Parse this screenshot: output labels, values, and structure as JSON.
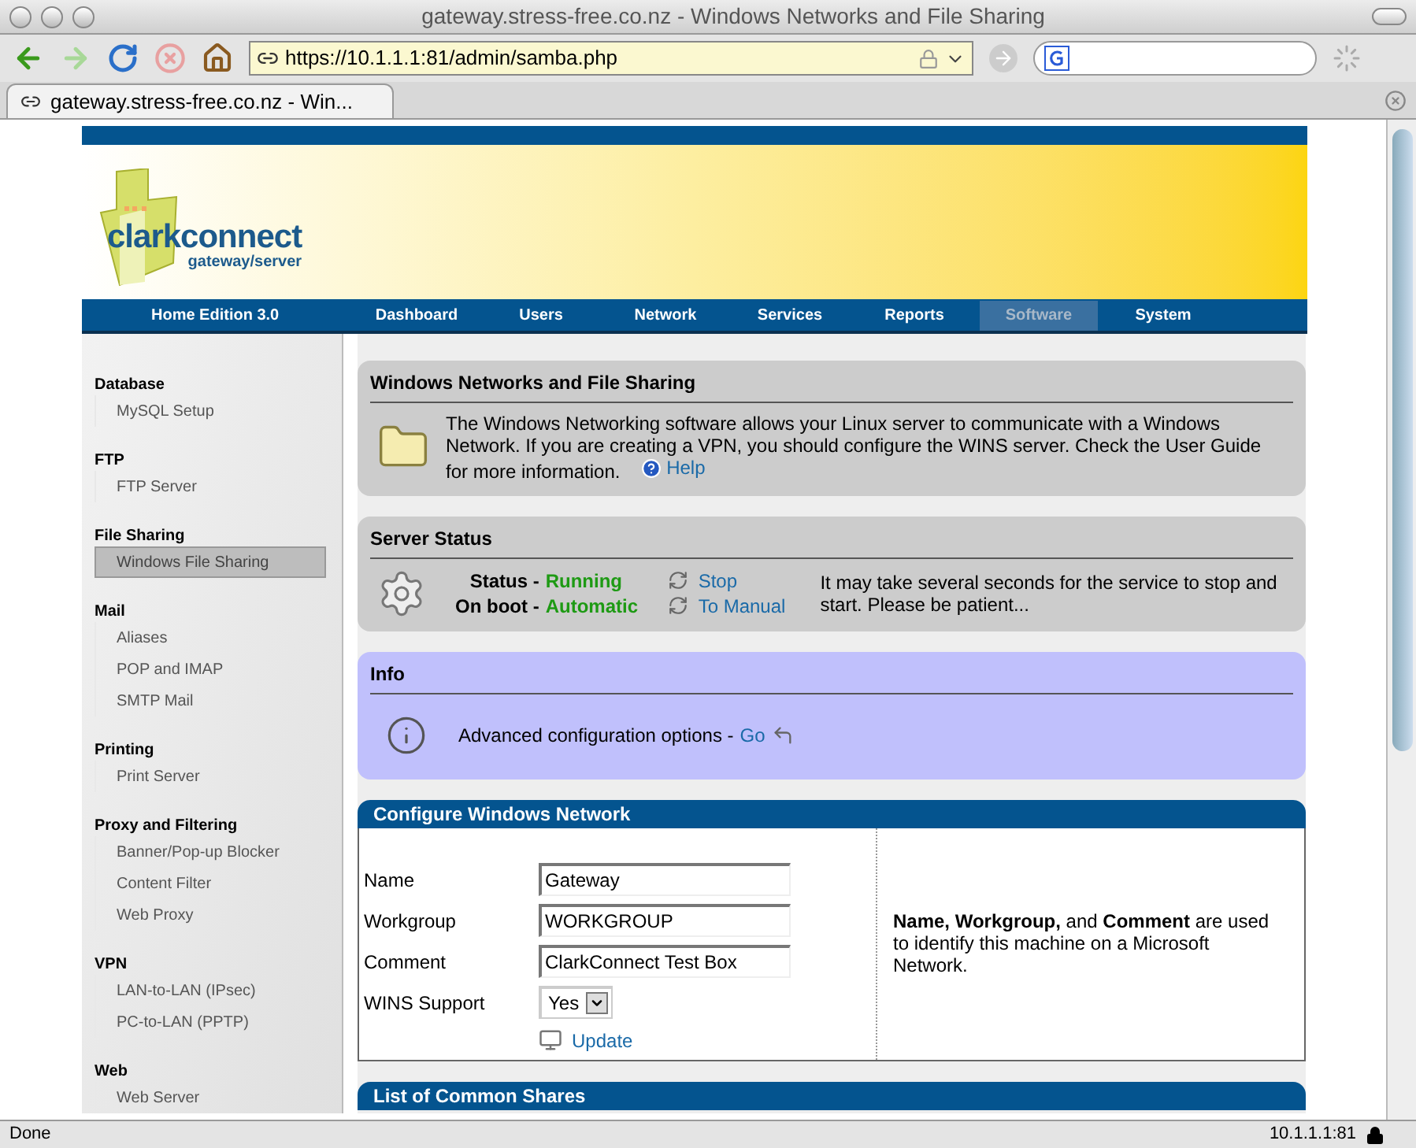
{
  "window": {
    "title": "gateway.stress-free.co.nz - Windows Networks and File Sharing"
  },
  "toolbar": {
    "url": "https://10.1.1.1:81/admin/samba.php"
  },
  "tabs": [
    {
      "label": "gateway.stress-free.co.nz - Win...",
      "selected": true
    }
  ],
  "page": {
    "brand": {
      "name": "clarkconnect",
      "tagline": "gateway/server"
    },
    "edition": "Home Edition 3.0",
    "nav": [
      {
        "label": "Dashboard",
        "selected": false
      },
      {
        "label": "Users",
        "selected": false
      },
      {
        "label": "Network",
        "selected": false
      },
      {
        "label": "Services",
        "selected": false
      },
      {
        "label": "Reports",
        "selected": false
      },
      {
        "label": "Software",
        "selected": true
      },
      {
        "label": "System",
        "selected": false
      }
    ],
    "sidebar": [
      {
        "title": "Database",
        "items": [
          {
            "label": "MySQL Setup",
            "selected": false
          }
        ]
      },
      {
        "title": "FTP",
        "items": [
          {
            "label": "FTP Server",
            "selected": false
          }
        ]
      },
      {
        "title": "File Sharing",
        "items": [
          {
            "label": "Windows File Sharing",
            "selected": true
          }
        ]
      },
      {
        "title": "Mail",
        "items": [
          {
            "label": "Aliases",
            "selected": false
          },
          {
            "label": "POP and IMAP",
            "selected": false
          },
          {
            "label": "SMTP Mail",
            "selected": false
          }
        ]
      },
      {
        "title": "Printing",
        "items": [
          {
            "label": "Print Server",
            "selected": false
          }
        ]
      },
      {
        "title": "Proxy and Filtering",
        "items": [
          {
            "label": "Banner/Pop-up Blocker",
            "selected": false
          },
          {
            "label": "Content Filter",
            "selected": false
          },
          {
            "label": "Web Proxy",
            "selected": false
          }
        ]
      },
      {
        "title": "VPN",
        "items": [
          {
            "label": "LAN-to-LAN (IPsec)",
            "selected": false
          },
          {
            "label": "PC-to-LAN (PPTP)",
            "selected": false
          }
        ]
      },
      {
        "title": "Web",
        "items": [
          {
            "label": "Web Server",
            "selected": false
          }
        ]
      }
    ],
    "intro": {
      "title": "Windows Networks and File Sharing",
      "text": "The Windows Networking software allows your Linux server to communicate with a Windows Network.  If you are creating a VPN, you should configure the WINS server.  Check the User Guide for more information.",
      "help": "Help"
    },
    "server_status": {
      "title": "Server Status",
      "rows": [
        {
          "label": "Status -",
          "value": "Running",
          "action": "Stop"
        },
        {
          "label": "On boot -",
          "value": "Automatic",
          "action": "To Manual"
        }
      ],
      "note": "It may take several seconds for the service to stop and start.  Please be patient..."
    },
    "info": {
      "title": "Info",
      "text": "Advanced configuration options -",
      "link": "Go"
    },
    "configure": {
      "title": "Configure Windows Network",
      "fields": [
        {
          "kind": "text",
          "label": "Name",
          "value": "Gateway"
        },
        {
          "kind": "text",
          "label": "Workgroup",
          "value": "WORKGROUP"
        },
        {
          "kind": "text",
          "label": "Comment",
          "value": "ClarkConnect Test Box"
        },
        {
          "kind": "select",
          "label": "WINS Support",
          "value": "Yes"
        }
      ],
      "button": "Update",
      "note": "**Name, Workgroup,** and **Comment** are used to identify this machine on a Microsoft Network."
    },
    "shares": {
      "title": "List of Common Shares"
    }
  },
  "status_bar": {
    "text": "Done",
    "host": "10.1.1.1:81"
  }
}
